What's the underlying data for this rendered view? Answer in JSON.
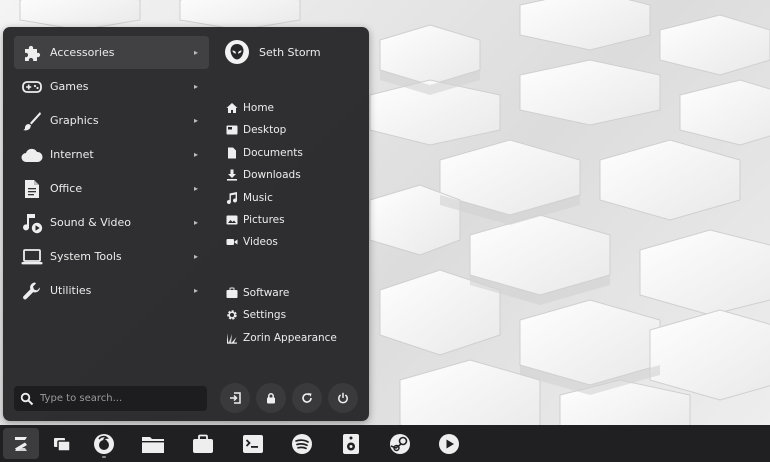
{
  "menu": {
    "categories": [
      {
        "label": "Accessories",
        "icon": "puzzle-icon"
      },
      {
        "label": "Games",
        "icon": "gamepad-icon"
      },
      {
        "label": "Graphics",
        "icon": "paintbrush-icon"
      },
      {
        "label": "Internet",
        "icon": "cloud-icon"
      },
      {
        "label": "Office",
        "icon": "document-icon"
      },
      {
        "label": "Sound & Video",
        "icon": "music-video-icon"
      },
      {
        "label": "System Tools",
        "icon": "laptop-icon"
      },
      {
        "label": "Utilities",
        "icon": "wrench-icon"
      }
    ],
    "active_category": "Accessories",
    "user": {
      "name": "Seth Storm",
      "avatar_icon": "alien-avatar-icon"
    },
    "places": [
      {
        "label": "Home",
        "icon": "home-icon"
      },
      {
        "label": "Desktop",
        "icon": "desktop-icon"
      },
      {
        "label": "Documents",
        "icon": "file-icon"
      },
      {
        "label": "Downloads",
        "icon": "download-icon"
      },
      {
        "label": "Music",
        "icon": "music-note-icon"
      },
      {
        "label": "Pictures",
        "icon": "picture-icon"
      },
      {
        "label": "Videos",
        "icon": "video-camera-icon"
      }
    ],
    "system_items": [
      {
        "label": "Software",
        "icon": "briefcase-icon"
      },
      {
        "label": "Settings",
        "icon": "gear-icon"
      },
      {
        "label": "Zorin Appearance",
        "icon": "appearance-icon"
      }
    ],
    "search": {
      "placeholder": "Type to search..."
    },
    "power_buttons": [
      "logout-icon",
      "lock-icon",
      "restart-icon",
      "power-icon"
    ]
  },
  "taskbar": {
    "items": [
      {
        "name": "zorin-menu",
        "icon": "zorin-logo-icon",
        "active": true
      },
      {
        "name": "workspaces",
        "icon": "windows-icon"
      },
      {
        "name": "firefox",
        "icon": "firefox-icon",
        "running": true
      },
      {
        "name": "files",
        "icon": "folder-icon"
      },
      {
        "name": "software",
        "icon": "briefcase-icon"
      },
      {
        "name": "terminal",
        "icon": "terminal-icon"
      },
      {
        "name": "spotify",
        "icon": "spotify-icon"
      },
      {
        "name": "rhythmbox",
        "icon": "speaker-icon"
      },
      {
        "name": "steam",
        "icon": "steam-icon"
      },
      {
        "name": "videos",
        "icon": "play-icon"
      }
    ]
  },
  "colors": {
    "menu_bg": "#28282a",
    "taskbar_bg": "#202022",
    "text": "#ececec",
    "wallpaper": "#e6e6e6"
  }
}
